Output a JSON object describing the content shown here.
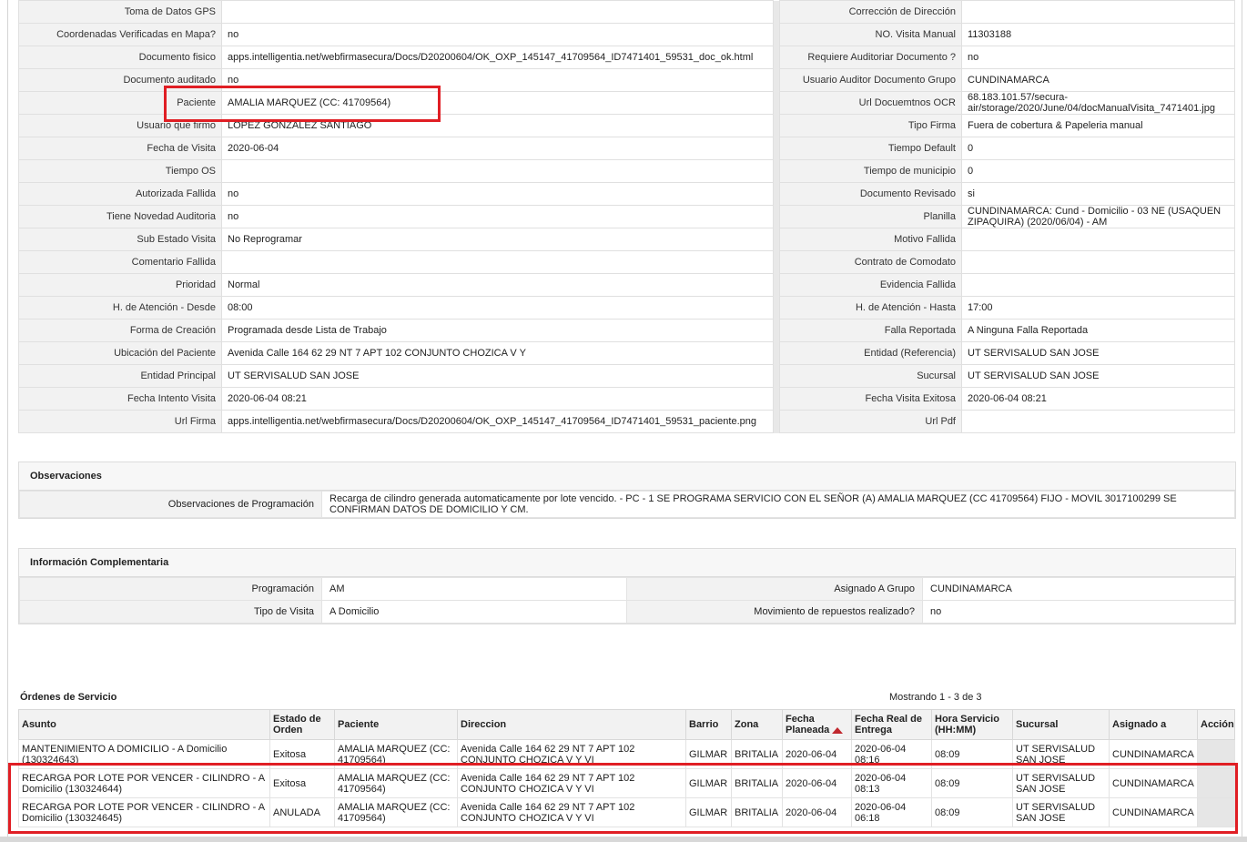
{
  "detail": {
    "rows": [
      {
        "l1": "Toma de Datos GPS",
        "v1": "",
        "l2": "Corrección de Dirección",
        "v2": ""
      },
      {
        "l1": "Coordenadas Verificadas en Mapa?",
        "v1": "no",
        "l2": "NO. Visita Manual",
        "v2": "11303188"
      },
      {
        "l1": "Documento fisico",
        "v1": "apps.intelligentia.net/webfirmasecura/Docs/D20200604/OK_OXP_145147_41709564_ID7471401_59531_doc_ok.html",
        "l2": "Requiere Auditoriar Documento ?",
        "v2": "no"
      },
      {
        "l1": "Documento auditado",
        "v1": "no",
        "l2": "Usuario Auditor Documento Grupo",
        "v2": "CUNDINAMARCA"
      },
      {
        "l1": "Paciente",
        "v1": "AMALIA MARQUEZ (CC: 41709564)",
        "l2": "Url Docuemtnos OCR",
        "v2": "68.183.101.57/secura-air/storage/2020/June/04/docManualVisita_7471401.jpg"
      },
      {
        "l1": "Usuario que firmo",
        "v1": "LOPEZ GONZALEZ SANTIAGO",
        "l2": "Tipo Firma",
        "v2": "Fuera de cobertura & Papeleria manual"
      },
      {
        "l1": "Fecha de Visita",
        "v1": "2020-06-04",
        "l2": "Tiempo Default",
        "v2": "0"
      },
      {
        "l1": "Tiempo OS",
        "v1": "",
        "l2": "Tiempo de municipio",
        "v2": "0"
      },
      {
        "l1": "Autorizada Fallida",
        "v1": "no",
        "l2": "Documento Revisado",
        "v2": "si"
      },
      {
        "l1": "Tiene Novedad Auditoria",
        "v1": "no",
        "l2": "Planilla",
        "v2": "CUNDINAMARCA: Cund - Domicilio - 03 NE (USAQUEN ZIPAQUIRA) (2020/06/04) - AM"
      },
      {
        "l1": "Sub Estado Visita",
        "v1": "No Reprogramar",
        "l2": "Motivo Fallida",
        "v2": ""
      },
      {
        "l1": "Comentario Fallida",
        "v1": "",
        "l2": "Contrato de Comodato",
        "v2": ""
      },
      {
        "l1": "Prioridad",
        "v1": "Normal",
        "l2": "Evidencia Fallida",
        "v2": ""
      },
      {
        "l1": "H. de Atención - Desde",
        "v1": "08:00",
        "l2": "H. de Atención - Hasta",
        "v2": "17:00"
      },
      {
        "l1": "Forma de Creación",
        "v1": "Programada desde Lista de Trabajo",
        "l2": "Falla Reportada",
        "v2": "A Ninguna Falla Reportada"
      },
      {
        "l1": "Ubicación del Paciente",
        "v1": "Avenida Calle 164 62 29 NT 7 APT 102 CONJUNTO CHOZICA V Y",
        "l2": "Entidad (Referencia)",
        "v2": "UT SERVISALUD SAN JOSE"
      },
      {
        "l1": "Entidad Principal",
        "v1": "UT SERVISALUD SAN JOSE",
        "l2": "Sucursal",
        "v2": "UT SERVISALUD SAN JOSE"
      },
      {
        "l1": "Fecha Intento Visita",
        "v1": "2020-06-04 08:21",
        "l2": "Fecha Visita Exitosa",
        "v2": "2020-06-04 08:21"
      },
      {
        "l1": "Url Firma",
        "v1": "apps.intelligentia.net/webfirmasecura/Docs/D20200604/OK_OXP_145147_41709564_ID7471401_59531_paciente.png",
        "l2": "Url Pdf",
        "v2": ""
      }
    ]
  },
  "observaciones": {
    "title": "Observaciones",
    "label": "Observaciones de Programación",
    "value": "Recarga de cilindro generada automaticamente por lote vencido. - PC - 1 SE PROGRAMA SERVICIO CON EL SEÑOR (A) AMALIA MARQUEZ (CC 41709564) FIJO - MOVIL 3017100299 SE CONFIRMAN DATOS DE DOMICILIO Y CM."
  },
  "complementaria": {
    "title": "Información Complementaria",
    "programacion_label": "Programación",
    "programacion": "AM",
    "grupo_label": "Asignado A Grupo",
    "grupo": "CUNDINAMARCA",
    "tipo_label": "Tipo de Visita",
    "tipo": "A Domicilio",
    "repuestos_label": "Movimiento de repuestos realizado?",
    "repuestos": "no"
  },
  "orders": {
    "title": "Órdenes de Servicio",
    "count": "Mostrando 1 - 3 de 3",
    "headers": [
      "Asunto",
      "Estado de Orden",
      "Paciente",
      "Direccion",
      "Barrio",
      "Zona",
      "Fecha Planeada",
      "Fecha Real de Entrega",
      "Hora Servicio (HH:MM)",
      "Sucursal",
      "Asignado a",
      "Acción"
    ],
    "rows": [
      {
        "asunto": "MANTENIMIENTO A DOMICILIO - A Domicilio (130324643)",
        "estado": "Exitosa",
        "paciente": "AMALIA MARQUEZ (CC: 41709564)",
        "direccion": "Avenida Calle 164 62 29 NT 7 APT 102 CONJUNTO CHOZICA V Y VI",
        "barrio": "GILMAR",
        "zona": "BRITALIA",
        "fecha": "2020-06-04",
        "real": "2020-06-04 08:16",
        "hora": "08:09",
        "sucursal": "UT SERVISALUD SAN JOSE",
        "asignado": "CUNDINAMARCA"
      },
      {
        "asunto": "RECARGA POR LOTE POR VENCER - CILINDRO - A Domicilio (130324644)",
        "estado": "Exitosa",
        "paciente": "AMALIA MARQUEZ (CC: 41709564)",
        "direccion": "Avenida Calle 164 62 29 NT 7 APT 102 CONJUNTO CHOZICA V Y VI",
        "barrio": "GILMAR",
        "zona": "BRITALIA",
        "fecha": "2020-06-04",
        "real": "2020-06-04 08:13",
        "hora": "08:09",
        "sucursal": "UT SERVISALUD SAN JOSE",
        "asignado": "CUNDINAMARCA"
      },
      {
        "asunto": "RECARGA POR LOTE POR VENCER - CILINDRO - A Domicilio (130324645)",
        "estado": "ANULADA",
        "paciente": "AMALIA MARQUEZ (CC: 41709564)",
        "direccion": "Avenida Calle 164 62 29 NT 7 APT 102 CONJUNTO CHOZICA V Y VI",
        "barrio": "GILMAR",
        "zona": "BRITALIA",
        "fecha": "2020-06-04",
        "real": "2020-06-04 06:18",
        "hora": "08:09",
        "sucursal": "UT SERVISALUD SAN JOSE",
        "asignado": "CUNDINAMARCA"
      }
    ]
  },
  "colors": {
    "highlight": "#e01e24",
    "sort": "#c0272d"
  }
}
